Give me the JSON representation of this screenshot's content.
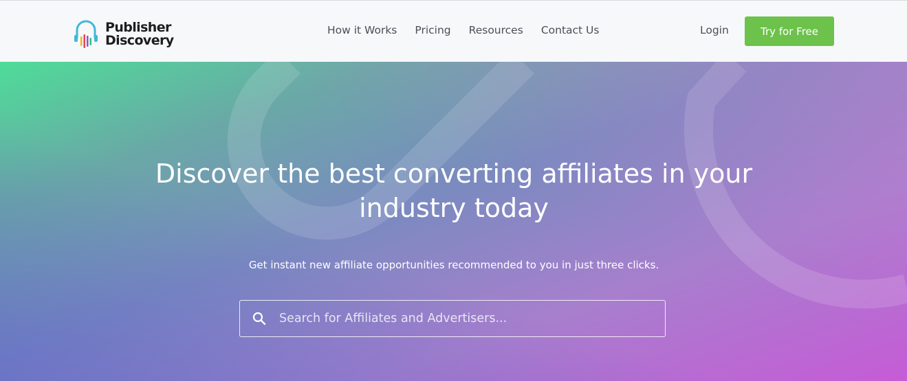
{
  "brand": {
    "line1": "Publisher",
    "line2": "Discovery",
    "logo_icon": "headphones-bars-icon",
    "bar_colors": [
      "#3fb8d8",
      "#f4b21e",
      "#e3455a",
      "#8d56c7",
      "#2fbf8a"
    ]
  },
  "nav": {
    "links": [
      "How it Works",
      "Pricing",
      "Resources",
      "Contact Us"
    ],
    "login": "Login",
    "cta": "Try for Free"
  },
  "hero": {
    "title": "Discover the best converting affiliates in your industry today",
    "subtitle": "Get instant new affiliate opportunities recommended to you in just three clicks.",
    "search_placeholder": "Search for Affiliates and Advertisers..."
  },
  "colors": {
    "cta_green": "#6cc24a",
    "gradient_start": "#4fdc98",
    "gradient_end": "#c65bd6"
  }
}
